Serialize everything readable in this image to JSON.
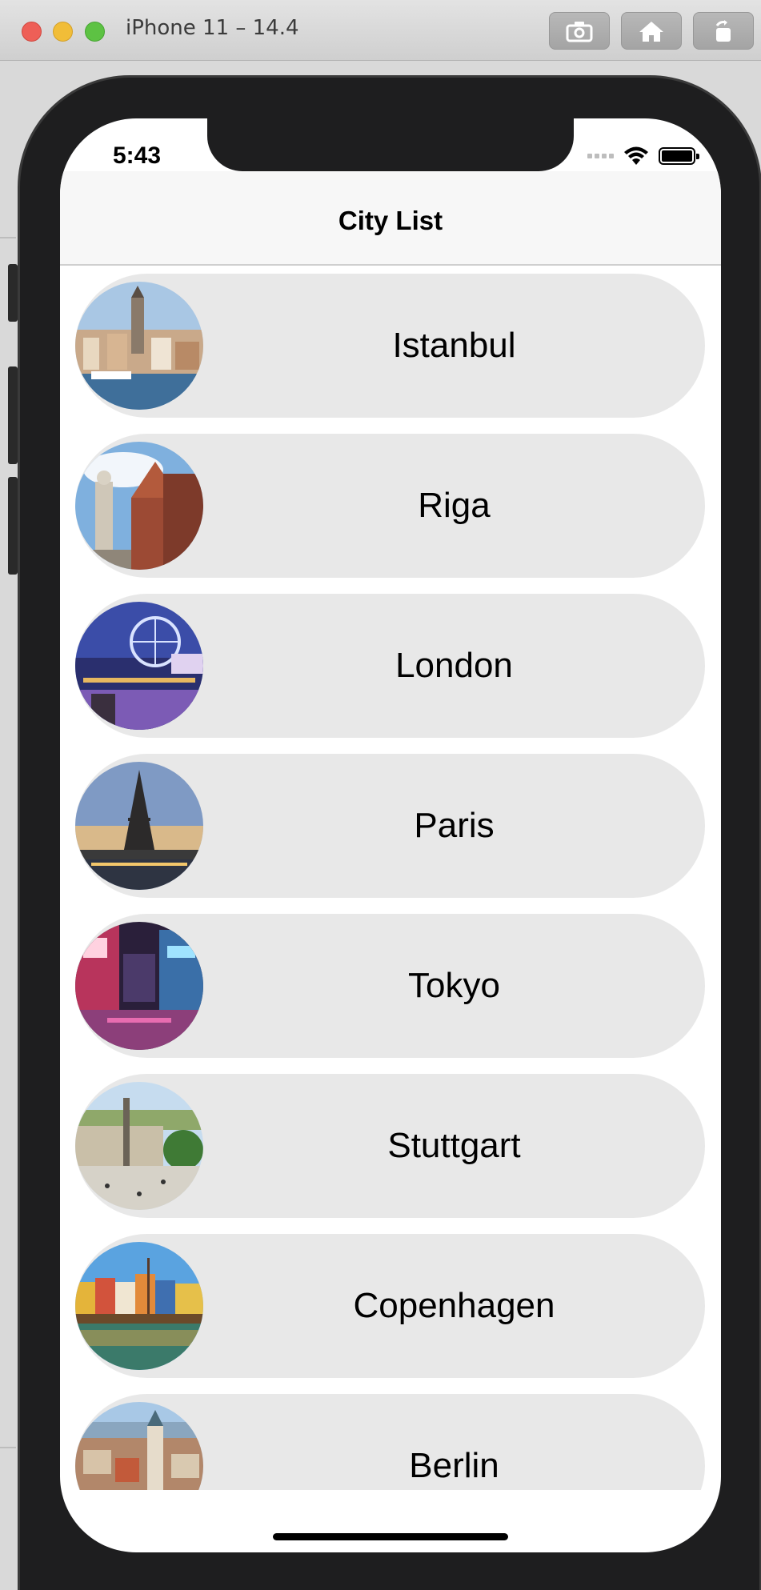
{
  "window": {
    "title": "iPhone 11 – 14.4"
  },
  "toolbar": {
    "screenshot_icon": "camera-icon",
    "home_icon": "home-icon",
    "rotate_icon": "rotate-icon"
  },
  "status_bar": {
    "time": "5:43"
  },
  "nav": {
    "title": "City List"
  },
  "cities": [
    {
      "name": "Istanbul",
      "image_icon": "istanbul-photo"
    },
    {
      "name": "Riga",
      "image_icon": "riga-photo"
    },
    {
      "name": "London",
      "image_icon": "london-photo"
    },
    {
      "name": "Paris",
      "image_icon": "paris-photo"
    },
    {
      "name": "Tokyo",
      "image_icon": "tokyo-photo"
    },
    {
      "name": "Stuttgart",
      "image_icon": "stuttgart-photo"
    },
    {
      "name": "Copenhagen",
      "image_icon": "copenhagen-photo"
    },
    {
      "name": "Berlin",
      "image_icon": "berlin-photo"
    }
  ],
  "colors": {
    "row_background": "#e8e8e8",
    "nav_background": "#f7f7f7",
    "device_frame": "#1e1e1f"
  }
}
